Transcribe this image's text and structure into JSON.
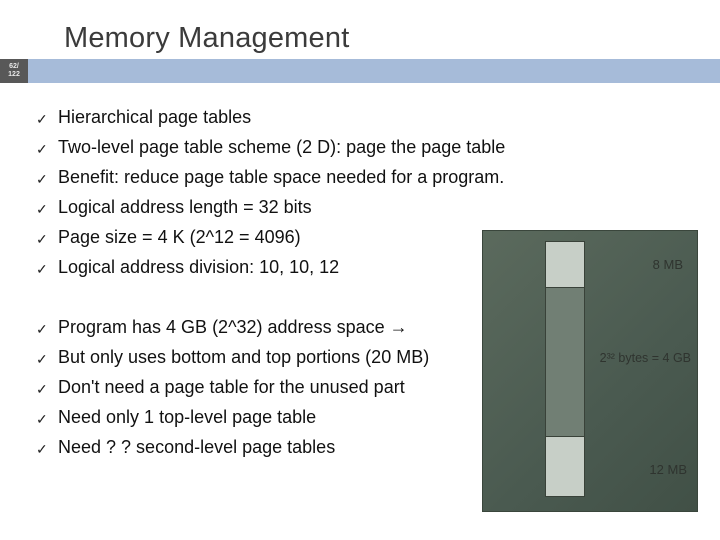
{
  "slide": {
    "title": "Memory Management",
    "page_num_top": "62/",
    "page_num_bot": "122",
    "bullets1": [
      "Hierarchical page tables",
      "Two-level page table scheme (2 D): page the page table",
      "Benefit: reduce page table space needed for a program.",
      "Logical address length = 32 bits",
      "Page size = 4 K (2^12 = 4096)",
      "Logical address division: 10, 10, 12"
    ],
    "bullets2": [
      "Program has 4 GB (2^32) address space →",
      "But only uses bottom and top portions (20 MB)",
      "Don't need a page table for the unused part",
      "Need only 1 top-level page table",
      "Need ? ? second-level page tables"
    ],
    "diagram": {
      "label_top": "8 MB",
      "label_mid": "2³² bytes = 4 GB",
      "label_bot": "12 MB"
    }
  }
}
